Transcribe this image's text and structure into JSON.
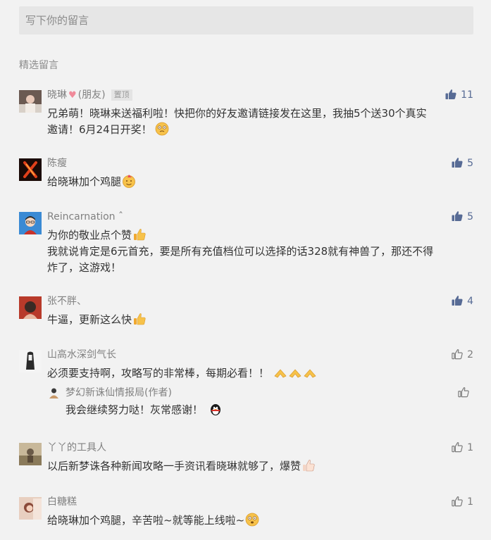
{
  "write": {
    "placeholder": "写下你的留言"
  },
  "section_title": "精选留言",
  "comments": [
    {
      "name": "晓琳",
      "friend_tag": "(朋友)",
      "pin_label": "置顶",
      "likes": "11",
      "text_1": "兄弟萌！晓琳来送福利啦！快把你的好友邀请链接发在这里，我抽5个送30个真实",
      "text_2": "邀请！6月24日开奖！"
    },
    {
      "name": "陈瘦",
      "likes": "5",
      "text": "给晓琳加个鸡腿"
    },
    {
      "name": "Reincarnation ˆ",
      "likes": "5",
      "text_1": "为你的敬业点个赞",
      "text_2": "我就说肯定是6元首充，要是所有充值档位可以选择的话328就有神兽了，那还不得",
      "text_3": "炸了，这游戏！"
    },
    {
      "name": "张不胖、",
      "likes": "4",
      "text": "牛逼，更新这么快"
    },
    {
      "name": "山高水深剑气长",
      "likes": "2",
      "text": "必须要支持啊，攻略写的非常棒，每期必看！！",
      "reply": {
        "name": "梦幻新诛仙情报局(作者)",
        "text": "我会继续努力哒！灰常感谢！"
      }
    },
    {
      "name": "丫丫的工具人",
      "likes": "1",
      "text": "以后新梦诛各种新闻攻略一手资讯看晓琳就够了，爆赞"
    },
    {
      "name": "白糖糕",
      "likes": "1",
      "text": "给晓琳加个鸡腿，辛苦啦~就等能上线啦~"
    }
  ],
  "colors": {
    "accent": "#576b95",
    "background": "#f2f2f2",
    "text": "#333333",
    "meta": "#808080"
  },
  "icons": {
    "like_filled": "thumbs-up-filled-icon",
    "like_outline": "thumbs-up-outline-icon",
    "heart": "heart-icon"
  }
}
